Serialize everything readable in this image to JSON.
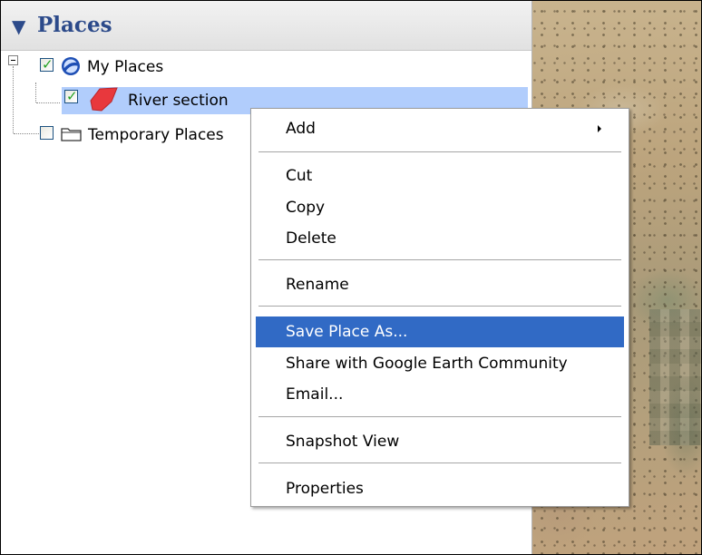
{
  "panel": {
    "title": "Places",
    "collapse_icon": "triangle-down-icon"
  },
  "tree": {
    "my_places": {
      "label": "My Places",
      "checked": true,
      "icon": "google-earth-globe-icon"
    },
    "river_section": {
      "label": "River section",
      "checked": true,
      "icon": "red-polygon-icon",
      "selected": true
    },
    "temporary_places": {
      "label": "Temporary Places",
      "checked": false,
      "icon": "folder-icon"
    }
  },
  "context_menu": {
    "add": "Add",
    "cut": "Cut",
    "copy": "Copy",
    "delete": "Delete",
    "rename": "Rename",
    "save_place_as": "Save Place As...",
    "share": "Share with Google Earth Community",
    "email": "Email...",
    "snapshot_view": "Snapshot View",
    "properties": "Properties",
    "highlighted_item": "Save Place As..."
  },
  "colors": {
    "title": "#2c4a8a",
    "selection": "#b1cdfc",
    "menu_highlight": "#316ac5",
    "check": "#21a121"
  }
}
